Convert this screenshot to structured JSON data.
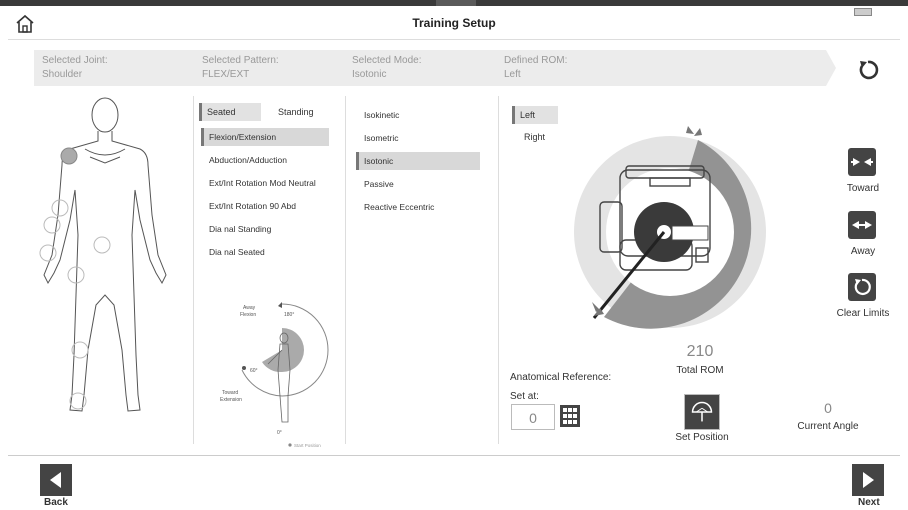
{
  "header": {
    "title": "Training Setup"
  },
  "breadcrumb": {
    "joint": {
      "label": "Selected Joint:",
      "value": "Shoulder"
    },
    "pattern": {
      "label": "Selected Pattern:",
      "value": "FLEX/EXT"
    },
    "mode": {
      "label": "Selected Mode:",
      "value": "Isotonic"
    },
    "rom": {
      "label": "Defined ROM:",
      "value": "Left"
    }
  },
  "position_toggle": {
    "seated": "Seated",
    "standing": "Standing",
    "selected": "Seated"
  },
  "patterns": [
    {
      "label": "Flexion/Extension",
      "selected": true
    },
    {
      "label": "Abduction/Adduction",
      "selected": false
    },
    {
      "label": "Ext/Int Rotation Mod Neutral",
      "selected": false
    },
    {
      "label": "Ext/Int Rotation 90 Abd",
      "selected": false
    },
    {
      "label": "Dia nal Standing",
      "selected": false
    },
    {
      "label": "Dia nal Seated",
      "selected": false
    }
  ],
  "diagram": {
    "away": "Away",
    "flexion": "Flexion",
    "deg180": "180°",
    "deg60": "60°",
    "toward": "Toward",
    "extension": "Extension",
    "deg0": "0°",
    "start_position": "Start Position"
  },
  "modes": [
    {
      "label": "Isokinetic",
      "selected": false
    },
    {
      "label": "Isometric",
      "selected": false
    },
    {
      "label": "Isotonic",
      "selected": true
    },
    {
      "label": "Passive",
      "selected": false
    },
    {
      "label": "Reactive Eccentric",
      "selected": false
    }
  ],
  "sides": [
    {
      "label": "Left",
      "selected": true
    },
    {
      "label": "Right",
      "selected": false
    }
  ],
  "rom": {
    "value": "210",
    "label": "Total ROM"
  },
  "controls": {
    "toward": "Toward",
    "away": "Away",
    "clear": "Clear Limits"
  },
  "anatomical_reference": "Anatomical Reference:",
  "set_at": {
    "label": "Set at:",
    "value": "0"
  },
  "set_position": "Set Position",
  "current_angle": {
    "value": "0",
    "label": "Current Angle"
  },
  "nav": {
    "back": "Back",
    "next": "Next"
  },
  "colors": {
    "accent_dark": "#444444",
    "rom_gray": "#8f8f8f",
    "light_gray": "#e0e0e0"
  }
}
